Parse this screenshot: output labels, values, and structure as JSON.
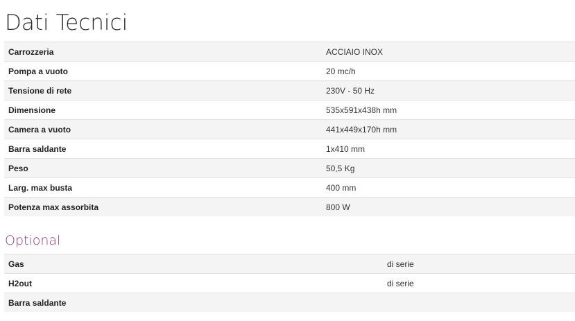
{
  "title": "Dati Tecnici",
  "tech_specs": [
    {
      "label": "Carrozzeria",
      "value": "ACCIAIO INOX"
    },
    {
      "label": "Pompa a vuoto",
      "value": "20 mc/h"
    },
    {
      "label": "Tensione di rete",
      "value": "230V - 50 Hz"
    },
    {
      "label": "Dimensione",
      "value": "535x591x438h mm"
    },
    {
      "label": "Camera a vuoto",
      "value": "441x449x170h mm"
    },
    {
      "label": "Barra saldante",
      "value": "1x410 mm"
    },
    {
      "label": "Peso",
      "value": "50,5 Kg"
    },
    {
      "label": "Larg. max busta",
      "value": "400 mm"
    },
    {
      "label": "Potenza max assorbita",
      "value": "800 W"
    }
  ],
  "optional_title": "Optional",
  "optional": [
    {
      "label": "Gas",
      "value": "di serie"
    },
    {
      "label": "H2out",
      "value": "di serie"
    },
    {
      "label": "Barra saldante",
      "value": ""
    }
  ],
  "colors": {
    "optional_heading": "#8e3a7e",
    "row_alt_background": "#f4f4f4",
    "row_border": "#e3e3e3"
  }
}
